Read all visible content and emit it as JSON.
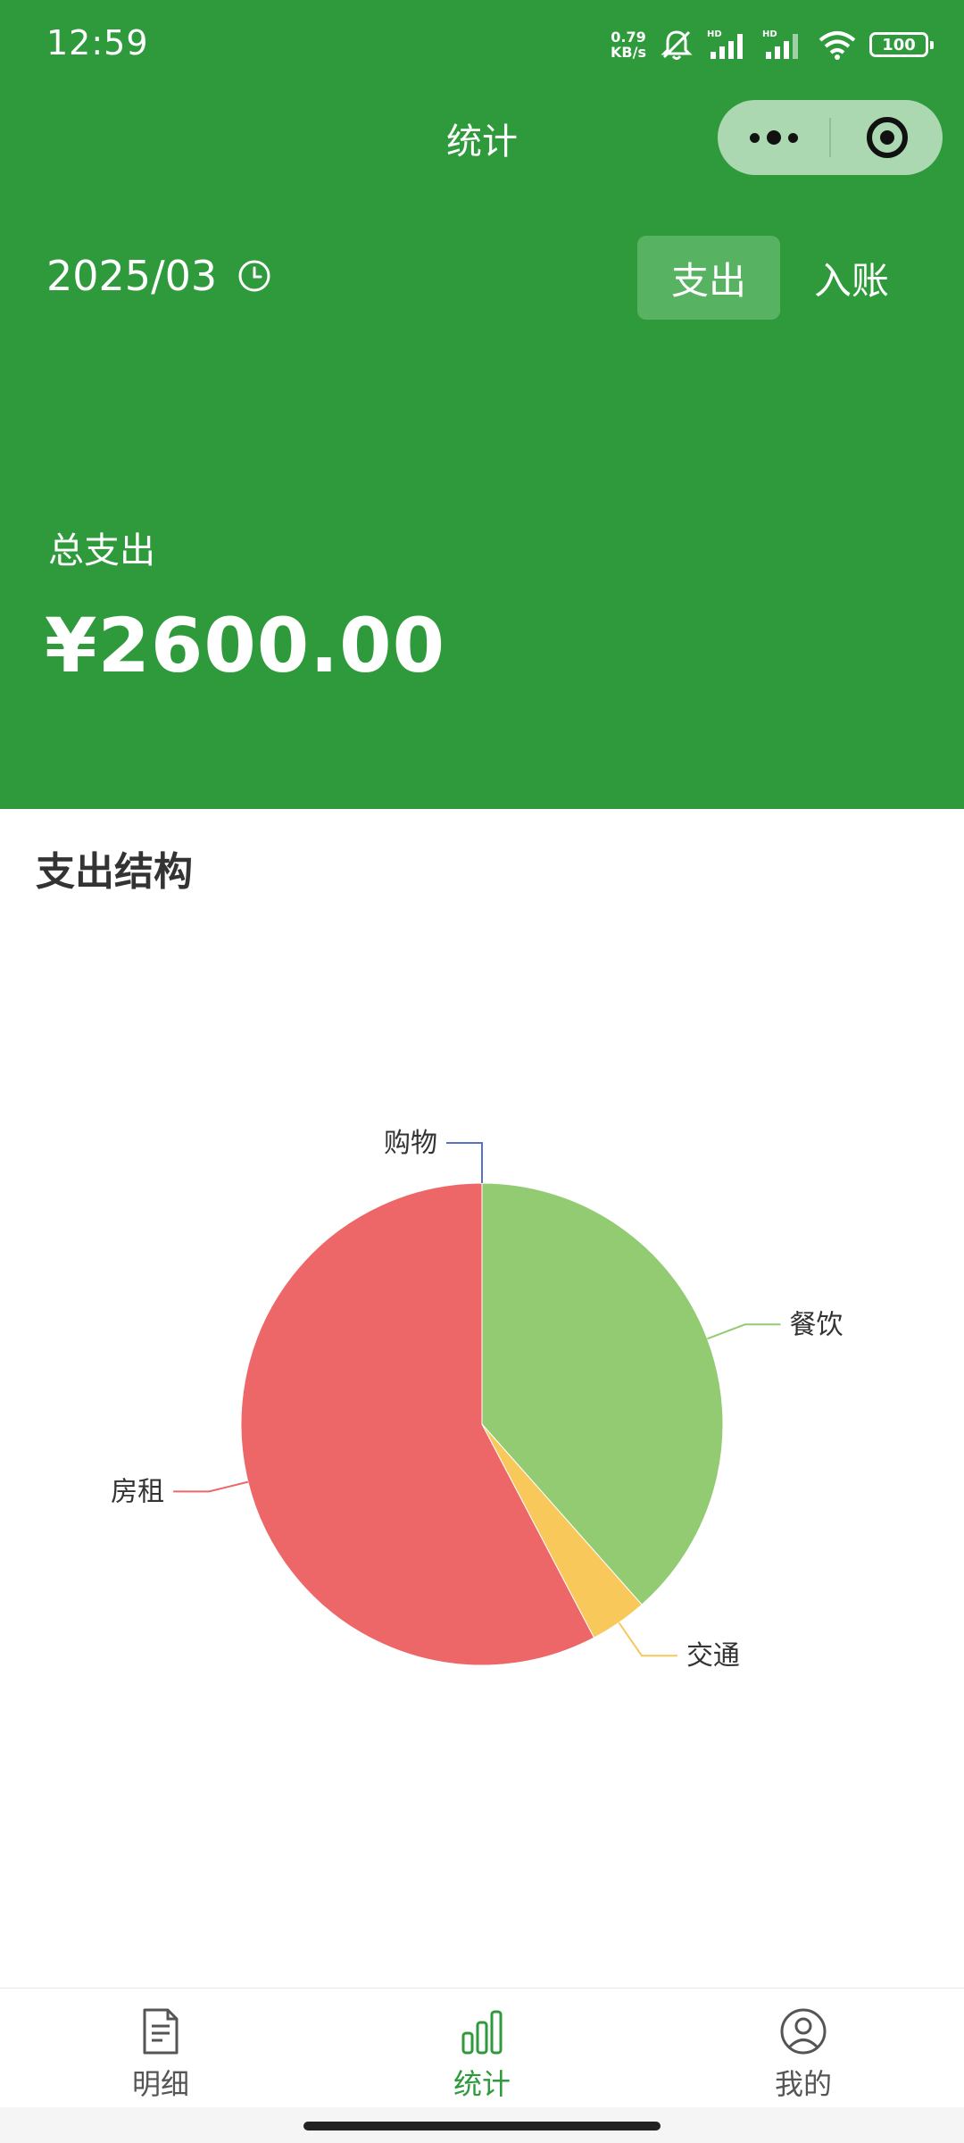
{
  "status_bar": {
    "time": "12:59",
    "net_speed_value": "0.79",
    "net_speed_unit": "KB/s",
    "battery": "100"
  },
  "nav": {
    "title": "统计"
  },
  "filter": {
    "date": "2025/03",
    "tabs": [
      {
        "label": "支出",
        "active": true
      },
      {
        "label": "入账",
        "active": false
      }
    ]
  },
  "summary": {
    "total_label": "总支出",
    "total_amount": "¥2600.00"
  },
  "section": {
    "title": "支出结构"
  },
  "chart_data": {
    "type": "pie",
    "slices": [
      {
        "label": "餐饮",
        "value": 1000,
        "color": "#93cb72"
      },
      {
        "label": "交通",
        "value": 100,
        "color": "#f8c85a"
      },
      {
        "label": "房租",
        "value": 1500,
        "color": "#ee6768"
      },
      {
        "label": "购物",
        "value": 0,
        "color": "#5571c8"
      }
    ]
  },
  "tabbar": {
    "items": [
      {
        "label": "明细",
        "icon": "document-icon",
        "active": false
      },
      {
        "label": "统计",
        "icon": "bar-chart-icon",
        "active": true
      },
      {
        "label": "我的",
        "icon": "user-icon",
        "active": false
      }
    ],
    "accent": "#2e9a3b"
  }
}
